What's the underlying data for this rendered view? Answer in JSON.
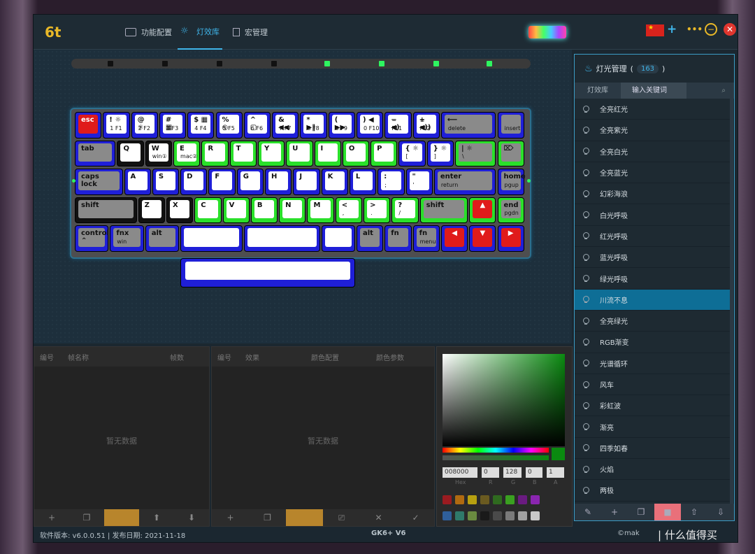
{
  "tabs": [
    {
      "label": "功能配置"
    },
    {
      "label": "灯效库"
    },
    {
      "label": "宏管理"
    }
  ],
  "keyboard": {
    "rows": [
      [
        {
          "t": "esc",
          "c": "r",
          "w": 1
        },
        {
          "t": "! ☼\n1 F1",
          "c": "b",
          "w": 1
        },
        {
          "t": "@ ☼\n2 F2",
          "c": "b",
          "w": 1
        },
        {
          "t": "# ▦\n3 F3",
          "c": "b",
          "w": 1
        },
        {
          "t": "$ ▦\n4 F4",
          "c": "b",
          "w": 1
        },
        {
          "t": "% ◎\n5 F5",
          "c": "b",
          "w": 1
        },
        {
          "t": "^ ▢\n6 F6",
          "c": "b",
          "w": 1
        },
        {
          "t": "& ◀◀\n7 F7",
          "c": "b",
          "w": 1
        },
        {
          "t": "* ▶‖\n8 F8",
          "c": "b",
          "w": 1
        },
        {
          "t": "( ▶▶\n9 F9",
          "c": "b",
          "w": 1
        },
        {
          "t": ") ◀\n0 F10",
          "c": "b",
          "w": 1
        },
        {
          "t": "− ◀)\n− F11",
          "c": "b",
          "w": 1
        },
        {
          "t": "+ ◀))\n= F12",
          "c": "b",
          "w": 1
        },
        {
          "t": "⟵\ndelete",
          "c": "b",
          "w": 2,
          "g": 1
        },
        {
          "t": "\ninsert",
          "c": "b",
          "w": 1,
          "g": 1
        }
      ],
      [
        {
          "t": "tab",
          "c": "b",
          "w": 1.5,
          "g": 1
        },
        {
          "t": "Q",
          "c": "k",
          "w": 1
        },
        {
          "t": "W\nwin①",
          "c": "k",
          "w": 1
        },
        {
          "t": "E\nmac②",
          "c": "g",
          "w": 1
        },
        {
          "t": "R",
          "c": "g",
          "w": 1
        },
        {
          "t": "T",
          "c": "g",
          "w": 1
        },
        {
          "t": "Y",
          "c": "g",
          "w": 1
        },
        {
          "t": "U",
          "c": "g",
          "w": 1
        },
        {
          "t": "I",
          "c": "g",
          "w": 1
        },
        {
          "t": "O",
          "c": "g",
          "w": 1
        },
        {
          "t": "P",
          "c": "g",
          "w": 1
        },
        {
          "t": "{ ☼\n[",
          "c": "b",
          "w": 1
        },
        {
          "t": "} ☼\n]",
          "c": "b",
          "w": 1
        },
        {
          "t": "| ☼\n\\",
          "c": "g",
          "w": 1.5,
          "g": 1
        },
        {
          "t": "⌦",
          "c": "g",
          "w": 1,
          "g": 1
        }
      ],
      [
        {
          "t": "caps lock",
          "c": "b",
          "w": 1.75,
          "g": 1
        },
        {
          "t": "A",
          "c": "b",
          "w": 1
        },
        {
          "t": "S",
          "c": "b",
          "w": 1
        },
        {
          "t": "D",
          "c": "b",
          "w": 1
        },
        {
          "t": "F",
          "c": "b",
          "w": 1
        },
        {
          "t": "G",
          "c": "b",
          "w": 1
        },
        {
          "t": "H",
          "c": "b",
          "w": 1
        },
        {
          "t": "J",
          "c": "b",
          "w": 1
        },
        {
          "t": "K",
          "c": "b",
          "w": 1
        },
        {
          "t": "L",
          "c": "b",
          "w": 1
        },
        {
          "t": ":\n;",
          "c": "b",
          "w": 1
        },
        {
          "t": "\"\n'",
          "c": "b",
          "w": 1
        },
        {
          "t": "enter\nreturn",
          "c": "b",
          "w": 2.25,
          "g": 1
        },
        {
          "t": "home\npgup",
          "c": "b",
          "w": 1,
          "g": 1
        }
      ],
      [
        {
          "t": "shift",
          "c": "k",
          "w": 2.25,
          "g": 1
        },
        {
          "t": "Z",
          "c": "k",
          "w": 1
        },
        {
          "t": "X",
          "c": "k",
          "w": 1
        },
        {
          "t": "C",
          "c": "g",
          "w": 1
        },
        {
          "t": "V",
          "c": "g",
          "w": 1
        },
        {
          "t": "B",
          "c": "g",
          "w": 1
        },
        {
          "t": "N",
          "c": "g",
          "w": 1
        },
        {
          "t": "M",
          "c": "g",
          "w": 1
        },
        {
          "t": "<\n,",
          "c": "g",
          "w": 1
        },
        {
          "t": ">\n.",
          "c": "g",
          "w": 1
        },
        {
          "t": "?\n/",
          "c": "g",
          "w": 1
        },
        {
          "t": "shift",
          "c": "g",
          "w": 1.75,
          "g": 1
        },
        {
          "t": "▲",
          "c": "gr",
          "w": 1
        },
        {
          "t": "end\npgdn",
          "c": "g",
          "w": 1,
          "g": 1
        }
      ],
      [
        {
          "t": "control ⌃",
          "c": "b",
          "w": 1.25,
          "g": 1
        },
        {
          "t": "fnx\nwin",
          "c": "b",
          "w": 1.25,
          "g": 1
        },
        {
          "t": "alt",
          "c": "b",
          "w": 1.25,
          "g": 1
        },
        {
          "t": "",
          "c": "b",
          "w": 2.25
        },
        {
          "t": "",
          "c": "b",
          "w": 2.75
        },
        {
          "t": "",
          "c": "b",
          "w": 1.25
        },
        {
          "t": "alt",
          "c": "b",
          "w": 1,
          "g": 1
        },
        {
          "t": "fn",
          "c": "b",
          "w": 1,
          "g": 1
        },
        {
          "t": "fn\nmenu",
          "c": "b",
          "w": 1,
          "g": 1
        },
        {
          "t": "◀",
          "c": "r",
          "w": 1
        },
        {
          "t": "▼",
          "c": "r",
          "w": 1
        },
        {
          "t": "▶",
          "c": "r",
          "w": 1
        }
      ]
    ]
  },
  "panel1": {
    "h1": "编号",
    "h2": "帧名称",
    "h3": "帧数",
    "empty": "暂无数据",
    "tools": [
      "+",
      "❐",
      "⬆",
      "⬆",
      "⬇"
    ]
  },
  "panel2": {
    "h1": "编号",
    "h2": "效果",
    "h3": "颜色配置",
    "h4": "颜色参数",
    "empty": "暂无数据",
    "tools": [
      "+",
      "❐",
      "",
      "⎚",
      "✕",
      "✓"
    ]
  },
  "picker": {
    "hex": "008000",
    "r": "0",
    "g": "128",
    "b": "0",
    "a": "1",
    "lhex": "Hex",
    "lr": "R",
    "lg": "G",
    "lb": "B",
    "la": "A",
    "swatches": [
      "#9a1b20",
      "#b06a10",
      "#b7a010",
      "#6a5a20",
      "#2f6a1f",
      "#3aa020",
      "#6a1b80",
      "#8a25b0",
      "#2f5f9a",
      "#2f7a6a",
      "#6a8a40",
      "#1a1a1a",
      "#4a4a4a",
      "#7a7a7a",
      "#a0a0a0",
      "#c8c8c8"
    ]
  },
  "right": {
    "title": "灯光管理",
    "count": "163",
    "tab1": "灯效库",
    "tab2": "输入关键词",
    "items": [
      "全亮红光",
      "全亮紫光",
      "全亮白光",
      "全亮蓝光",
      "幻彩海浪",
      "白光呼吸",
      "红光呼吸",
      "蓝光呼吸",
      "绿光呼吸",
      "川流不息",
      "全亮绿光",
      "RGB渐变",
      "光谱循环",
      "风车",
      "彩虹波",
      "渐亮",
      "四季如春",
      "火焰",
      "两极"
    ],
    "selected": 9,
    "tools": [
      "✎",
      "+",
      "❐",
      "■",
      "⇧",
      "⇩"
    ]
  },
  "status": {
    "version": "软件版本: v6.0.0.51 | 发布日期: 2021-11-18",
    "model": "GK6+ V6",
    "brand": "©mak",
    "watermark": "| 什么值得买"
  }
}
